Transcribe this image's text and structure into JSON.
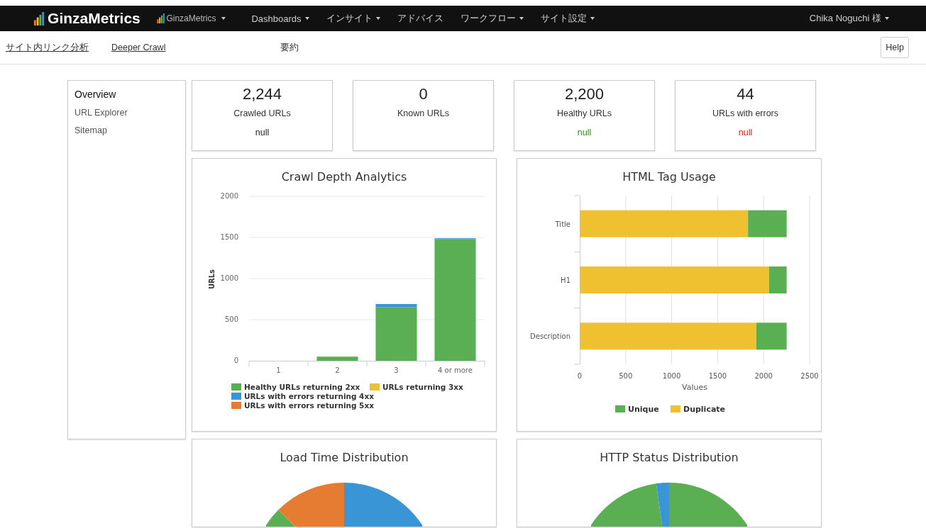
{
  "navbar": {
    "brand": "GinzaMetrics",
    "account_menu": "GinzaMetrics",
    "menus": [
      {
        "label": "Dashboards",
        "dropdown": true
      },
      {
        "label": "インサイト",
        "dropdown": true
      },
      {
        "label": "アドバイス",
        "dropdown": false
      },
      {
        "label": "ワークフロー",
        "dropdown": true
      },
      {
        "label": "サイト設定",
        "dropdown": true
      }
    ],
    "user": "Chika Noguchi 様"
  },
  "subnav": {
    "tabs": [
      {
        "label": "サイト内リンク分析",
        "selected": false
      },
      {
        "label": "Deeper Crawl",
        "selected": false
      },
      {
        "label": "要約",
        "selected": true
      }
    ],
    "help_button": "Help"
  },
  "sidebar": {
    "items": [
      {
        "label": "Overview",
        "selected": true
      },
      {
        "label": "URL Explorer",
        "selected": false
      },
      {
        "label": "Sitemap",
        "selected": false
      }
    ]
  },
  "stats": [
    {
      "value": "2,244",
      "label": "Crawled URLs",
      "note": "null",
      "kind": "neutral"
    },
    {
      "value": "0",
      "label": "Known URLs"
    },
    {
      "value": "2,200",
      "label": "Healthy URLs",
      "note": "null",
      "kind": "good"
    },
    {
      "value": "44",
      "label": "URLs with errors",
      "note": "null",
      "kind": "bad"
    }
  ],
  "crawl_depth": {
    "chart_data": {
      "type": "bar",
      "title": "Crawl Depth Analytics",
      "ylabel": "URLs",
      "stacked": true,
      "grid": true,
      "legend": "bottom",
      "categories": [
        "1",
        "2",
        "3",
        "4 or more"
      ],
      "ylim": [
        0,
        2000
      ],
      "yticks": [
        0,
        500,
        1000,
        1500,
        2000
      ],
      "series": [
        {
          "name": "Healthy URLs returning 2xx",
          "color": "#5aaf53",
          "values": [
            0,
            50,
            650,
            1480
          ]
        },
        {
          "name": "URLs returning 3xx",
          "color": "#efc131",
          "values": [
            0,
            0,
            0,
            0
          ]
        },
        {
          "name": "URLs with errors returning 4xx",
          "color": "#3a95d6",
          "values": [
            0,
            0,
            40,
            10
          ]
        },
        {
          "name": "URLs with errors returning 5xx",
          "color": "#e57c31",
          "values": [
            0,
            0,
            0,
            0
          ]
        }
      ]
    }
  },
  "html_tag_usage": {
    "chart_data": {
      "type": "bar",
      "title": "HTML Tag Usage",
      "xlabel": "Values",
      "orientation": "horizontal",
      "stacked": true,
      "grid": true,
      "legend": "bottom",
      "categories": [
        "Title",
        "H1",
        "Description"
      ],
      "xlim": [
        0,
        2500
      ],
      "xticks": [
        0,
        500,
        1000,
        1500,
        2000,
        2500
      ],
      "series": [
        {
          "name": "Unique",
          "color": "#5aaf53",
          "values": [
            420,
            190,
            330
          ]
        },
        {
          "name": "Duplicate",
          "color": "#efc131",
          "values": [
            1830,
            2060,
            1920
          ]
        }
      ]
    }
  },
  "load_time": {
    "title": "Load Time Distribution"
  },
  "http_status": {
    "title": "HTTP Status Distribution"
  }
}
